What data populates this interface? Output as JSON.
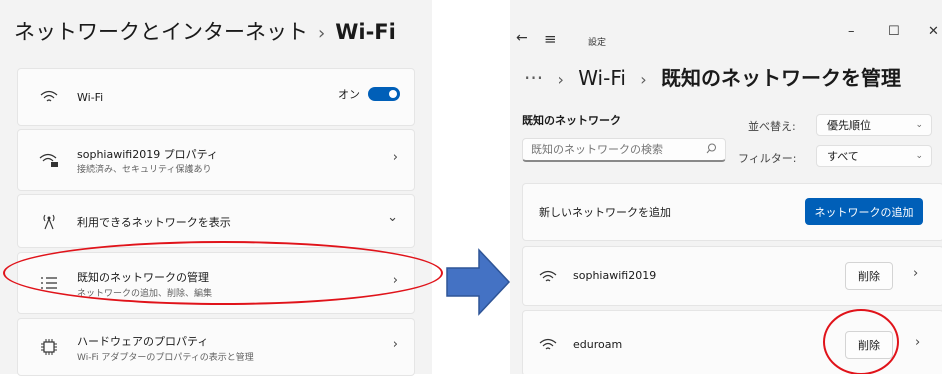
{
  "left": {
    "breadcrumb": {
      "parent": "ネットワークとインターネット",
      "separator": "›",
      "current": "Wi-Fi"
    },
    "wifi_row": {
      "label": "Wi-Fi",
      "toggle_label": "オン",
      "toggle_on": true
    },
    "network_props": {
      "title": "sophiawifi2019 プロパティ",
      "subtitle": "接続済み、セキュリティ保護あり",
      "chevron": "›"
    },
    "available": {
      "title": "利用できるネットワークを表示",
      "chevron": "⌄"
    },
    "manage_known": {
      "title": "既知のネットワークの管理",
      "subtitle": "ネットワークの追加、削除、編集",
      "chevron": "›"
    },
    "hardware": {
      "title": "ハードウェアのプロパティ",
      "subtitle": "Wi-Fi アダプターのプロパティの表示と管理",
      "chevron": "›"
    }
  },
  "right": {
    "titlebar": {
      "back": "←",
      "menu": "≡",
      "title": "設定",
      "minimize": "–",
      "maximize": "☐",
      "close": "✕"
    },
    "breadcrumb": {
      "more": "···",
      "sep": "›",
      "wifi": "Wi-Fi",
      "current": "既知のネットワークを管理"
    },
    "section_title": "既知のネットワーク",
    "search": {
      "placeholder": "既知のネットワークの検索"
    },
    "sort": {
      "label": "並べ替え:",
      "value": "優先順位"
    },
    "filter": {
      "label": "フィルター:",
      "value": "すべて"
    },
    "add_network": {
      "label": "新しいネットワークを追加",
      "button": "ネットワークの追加"
    },
    "networks": [
      {
        "name": "sophiawifi2019",
        "delete": "削除",
        "chevron": "›"
      },
      {
        "name": "eduroam",
        "delete": "削除",
        "chevron": "›"
      }
    ]
  },
  "colors": {
    "accent": "#005fb8",
    "highlight": "#e0131a",
    "arrow": "#4472c4"
  }
}
